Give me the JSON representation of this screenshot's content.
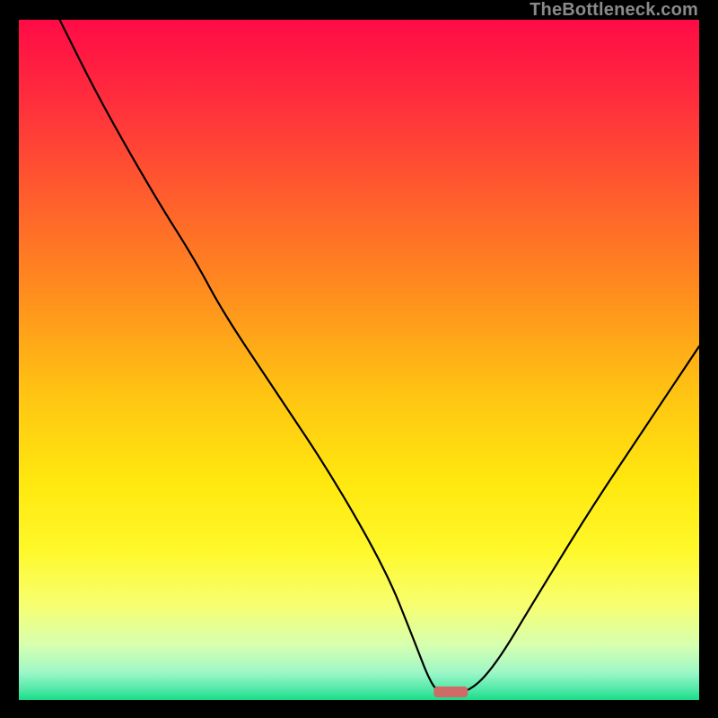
{
  "watermark": "TheBottleneck.com",
  "chart_data": {
    "type": "line",
    "title": "",
    "xlabel": "",
    "ylabel": "",
    "xlim": [
      0,
      100
    ],
    "ylim": [
      0,
      100
    ],
    "legend": false,
    "grid": false,
    "annotations": [],
    "background": {
      "type": "vertical-gradient",
      "stops": [
        {
          "pos": 0.0,
          "color": "#ff0b46"
        },
        {
          "pos": 0.12,
          "color": "#ff2e3d"
        },
        {
          "pos": 0.25,
          "color": "#ff5a2e"
        },
        {
          "pos": 0.4,
          "color": "#ff8d1e"
        },
        {
          "pos": 0.55,
          "color": "#ffc412"
        },
        {
          "pos": 0.68,
          "color": "#ffe80f"
        },
        {
          "pos": 0.78,
          "color": "#fff82a"
        },
        {
          "pos": 0.86,
          "color": "#f7ff70"
        },
        {
          "pos": 0.92,
          "color": "#d6ffb0"
        },
        {
          "pos": 0.96,
          "color": "#9cf7c7"
        },
        {
          "pos": 0.985,
          "color": "#4fe8a7"
        },
        {
          "pos": 1.0,
          "color": "#18dd87"
        }
      ]
    },
    "series": [
      {
        "name": "bottleneck-curve",
        "color": "#000000",
        "x": [
          6.0,
          12.0,
          20.0,
          26.0,
          30.0,
          38.0,
          46.0,
          54.0,
          58.0,
          60.5,
          62.0,
          66.0,
          70.0,
          76.0,
          84.0,
          92.0,
          100.0
        ],
        "y": [
          100.0,
          88.0,
          74.0,
          64.5,
          57.0,
          45.0,
          33.0,
          19.0,
          9.0,
          2.5,
          1.0,
          1.0,
          5.0,
          15.0,
          28.0,
          40.0,
          52.0
        ]
      }
    ],
    "marker": {
      "name": "optimal-marker",
      "shape": "rounded-rect",
      "color": "#cf6a66",
      "x_center": 63.5,
      "y_center": 1.2,
      "width_x": 5.0,
      "height_y": 1.6
    }
  }
}
